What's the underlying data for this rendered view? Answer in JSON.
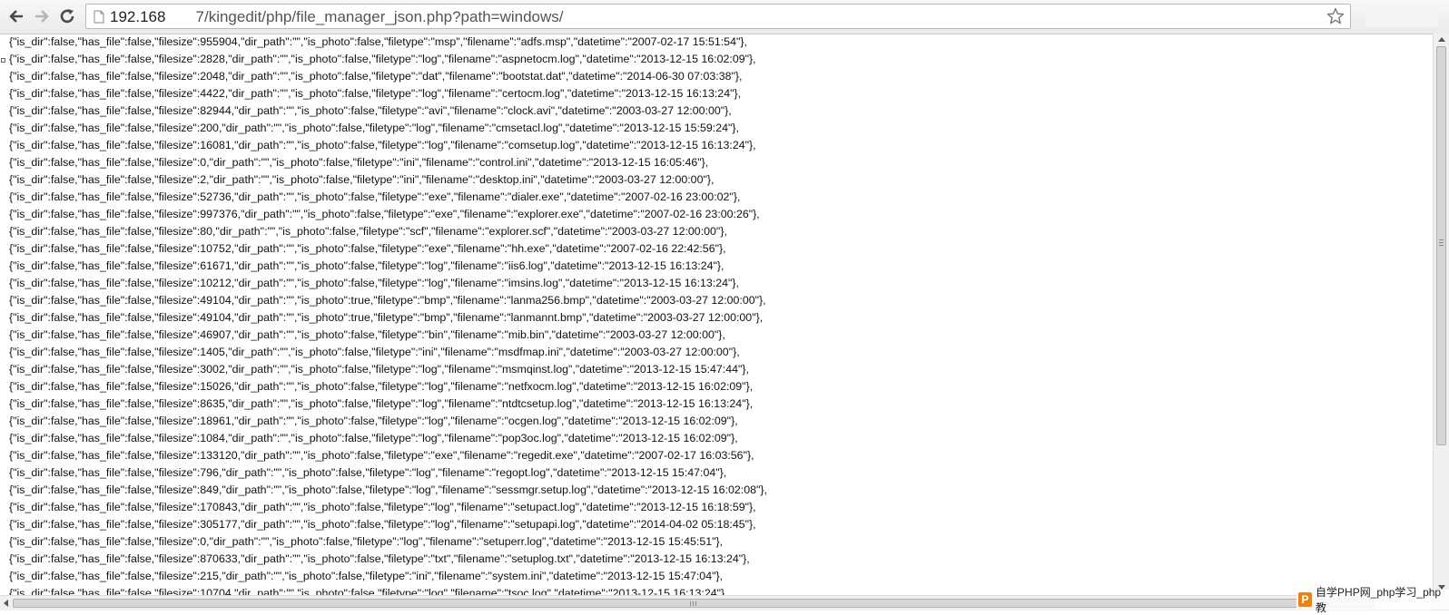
{
  "browser": {
    "url_host": "192.168",
    "url_path": "       7/kingedit/php/file_manager_json.php?path=windows/"
  },
  "lines": [
    "{\"is_dir\":false,\"has_file\":false,\"filesize\":955904,\"dir_path\":\"\",\"is_photo\":false,\"filetype\":\"msp\",\"filename\":\"adfs.msp\",\"datetime\":\"2007-02-17 15:51:54\"},",
    "{\"is_dir\":false,\"has_file\":false,\"filesize\":2828,\"dir_path\":\"\",\"is_photo\":false,\"filetype\":\"log\",\"filename\":\"aspnetocm.log\",\"datetime\":\"2013-12-15 16:02:09\"},",
    "{\"is_dir\":false,\"has_file\":false,\"filesize\":2048,\"dir_path\":\"\",\"is_photo\":false,\"filetype\":\"dat\",\"filename\":\"bootstat.dat\",\"datetime\":\"2014-06-30 07:03:38\"},",
    "{\"is_dir\":false,\"has_file\":false,\"filesize\":4422,\"dir_path\":\"\",\"is_photo\":false,\"filetype\":\"log\",\"filename\":\"certocm.log\",\"datetime\":\"2013-12-15 16:13:24\"},",
    "{\"is_dir\":false,\"has_file\":false,\"filesize\":82944,\"dir_path\":\"\",\"is_photo\":false,\"filetype\":\"avi\",\"filename\":\"clock.avi\",\"datetime\":\"2003-03-27 12:00:00\"},",
    "{\"is_dir\":false,\"has_file\":false,\"filesize\":200,\"dir_path\":\"\",\"is_photo\":false,\"filetype\":\"log\",\"filename\":\"cmsetacl.log\",\"datetime\":\"2013-12-15 15:59:24\"},",
    "{\"is_dir\":false,\"has_file\":false,\"filesize\":16081,\"dir_path\":\"\",\"is_photo\":false,\"filetype\":\"log\",\"filename\":\"comsetup.log\",\"datetime\":\"2013-12-15 16:13:24\"},",
    "{\"is_dir\":false,\"has_file\":false,\"filesize\":0,\"dir_path\":\"\",\"is_photo\":false,\"filetype\":\"ini\",\"filename\":\"control.ini\",\"datetime\":\"2013-12-15 16:05:46\"},",
    "{\"is_dir\":false,\"has_file\":false,\"filesize\":2,\"dir_path\":\"\",\"is_photo\":false,\"filetype\":\"ini\",\"filename\":\"desktop.ini\",\"datetime\":\"2003-03-27 12:00:00\"},",
    "{\"is_dir\":false,\"has_file\":false,\"filesize\":52736,\"dir_path\":\"\",\"is_photo\":false,\"filetype\":\"exe\",\"filename\":\"dialer.exe\",\"datetime\":\"2007-02-16 23:00:02\"},",
    "{\"is_dir\":false,\"has_file\":false,\"filesize\":997376,\"dir_path\":\"\",\"is_photo\":false,\"filetype\":\"exe\",\"filename\":\"explorer.exe\",\"datetime\":\"2007-02-16 23:00:26\"},",
    "{\"is_dir\":false,\"has_file\":false,\"filesize\":80,\"dir_path\":\"\",\"is_photo\":false,\"filetype\":\"scf\",\"filename\":\"explorer.scf\",\"datetime\":\"2003-03-27 12:00:00\"},",
    "{\"is_dir\":false,\"has_file\":false,\"filesize\":10752,\"dir_path\":\"\",\"is_photo\":false,\"filetype\":\"exe\",\"filename\":\"hh.exe\",\"datetime\":\"2007-02-16 22:42:56\"},",
    "{\"is_dir\":false,\"has_file\":false,\"filesize\":61671,\"dir_path\":\"\",\"is_photo\":false,\"filetype\":\"log\",\"filename\":\"iis6.log\",\"datetime\":\"2013-12-15 16:13:24\"},",
    "{\"is_dir\":false,\"has_file\":false,\"filesize\":10212,\"dir_path\":\"\",\"is_photo\":false,\"filetype\":\"log\",\"filename\":\"imsins.log\",\"datetime\":\"2013-12-15 16:13:24\"},",
    "{\"is_dir\":false,\"has_file\":false,\"filesize\":49104,\"dir_path\":\"\",\"is_photo\":true,\"filetype\":\"bmp\",\"filename\":\"lanma256.bmp\",\"datetime\":\"2003-03-27 12:00:00\"},",
    "{\"is_dir\":false,\"has_file\":false,\"filesize\":49104,\"dir_path\":\"\",\"is_photo\":true,\"filetype\":\"bmp\",\"filename\":\"lanmannt.bmp\",\"datetime\":\"2003-03-27 12:00:00\"},",
    "{\"is_dir\":false,\"has_file\":false,\"filesize\":46907,\"dir_path\":\"\",\"is_photo\":false,\"filetype\":\"bin\",\"filename\":\"mib.bin\",\"datetime\":\"2003-03-27 12:00:00\"},",
    "{\"is_dir\":false,\"has_file\":false,\"filesize\":1405,\"dir_path\":\"\",\"is_photo\":false,\"filetype\":\"ini\",\"filename\":\"msdfmap.ini\",\"datetime\":\"2003-03-27 12:00:00\"},",
    "{\"is_dir\":false,\"has_file\":false,\"filesize\":3002,\"dir_path\":\"\",\"is_photo\":false,\"filetype\":\"log\",\"filename\":\"msmqinst.log\",\"datetime\":\"2013-12-15 15:47:44\"},",
    "{\"is_dir\":false,\"has_file\":false,\"filesize\":15026,\"dir_path\":\"\",\"is_photo\":false,\"filetype\":\"log\",\"filename\":\"netfxocm.log\",\"datetime\":\"2013-12-15 16:02:09\"},",
    "{\"is_dir\":false,\"has_file\":false,\"filesize\":8635,\"dir_path\":\"\",\"is_photo\":false,\"filetype\":\"log\",\"filename\":\"ntdtcsetup.log\",\"datetime\":\"2013-12-15 16:13:24\"},",
    "{\"is_dir\":false,\"has_file\":false,\"filesize\":18961,\"dir_path\":\"\",\"is_photo\":false,\"filetype\":\"log\",\"filename\":\"ocgen.log\",\"datetime\":\"2013-12-15 16:02:09\"},",
    "{\"is_dir\":false,\"has_file\":false,\"filesize\":1084,\"dir_path\":\"\",\"is_photo\":false,\"filetype\":\"log\",\"filename\":\"pop3oc.log\",\"datetime\":\"2013-12-15 16:02:09\"},",
    "{\"is_dir\":false,\"has_file\":false,\"filesize\":133120,\"dir_path\":\"\",\"is_photo\":false,\"filetype\":\"exe\",\"filename\":\"regedit.exe\",\"datetime\":\"2007-02-17 16:03:56\"},",
    "{\"is_dir\":false,\"has_file\":false,\"filesize\":796,\"dir_path\":\"\",\"is_photo\":false,\"filetype\":\"log\",\"filename\":\"regopt.log\",\"datetime\":\"2013-12-15 15:47:04\"},",
    "{\"is_dir\":false,\"has_file\":false,\"filesize\":849,\"dir_path\":\"\",\"is_photo\":false,\"filetype\":\"log\",\"filename\":\"sessmgr.setup.log\",\"datetime\":\"2013-12-15 16:02:08\"},",
    "{\"is_dir\":false,\"has_file\":false,\"filesize\":170843,\"dir_path\":\"\",\"is_photo\":false,\"filetype\":\"log\",\"filename\":\"setupact.log\",\"datetime\":\"2013-12-15 16:18:59\"},",
    "{\"is_dir\":false,\"has_file\":false,\"filesize\":305177,\"dir_path\":\"\",\"is_photo\":false,\"filetype\":\"log\",\"filename\":\"setupapi.log\",\"datetime\":\"2014-04-02 05:18:45\"},",
    "{\"is_dir\":false,\"has_file\":false,\"filesize\":0,\"dir_path\":\"\",\"is_photo\":false,\"filetype\":\"log\",\"filename\":\"setuperr.log\",\"datetime\":\"2013-12-15 15:45:51\"},",
    "{\"is_dir\":false,\"has_file\":false,\"filesize\":870633,\"dir_path\":\"\",\"is_photo\":false,\"filetype\":\"txt\",\"filename\":\"setuplog.txt\",\"datetime\":\"2013-12-15 16:13:24\"},",
    "{\"is_dir\":false,\"has_file\":false,\"filesize\":215,\"dir_path\":\"\",\"is_photo\":false,\"filetype\":\"ini\",\"filename\":\"system.ini\",\"datetime\":\"2013-12-15 15:47:04\"},",
    "{\"is_dir\":false,\"has_file\":false,\"filesize\":10704,\"dir_path\":\"\",\"is_photo\":false,\"filetype\":\"log\",\"filename\":\"tsoc.log\",\"datetime\":\"2013-12-15 16:13:24\"},"
  ],
  "watermark": {
    "logo_letter": "P",
    "text": "自学PHP网_php学习_php教"
  },
  "colors": {
    "text": "#111111",
    "watermark_logo": "#e8831c"
  }
}
